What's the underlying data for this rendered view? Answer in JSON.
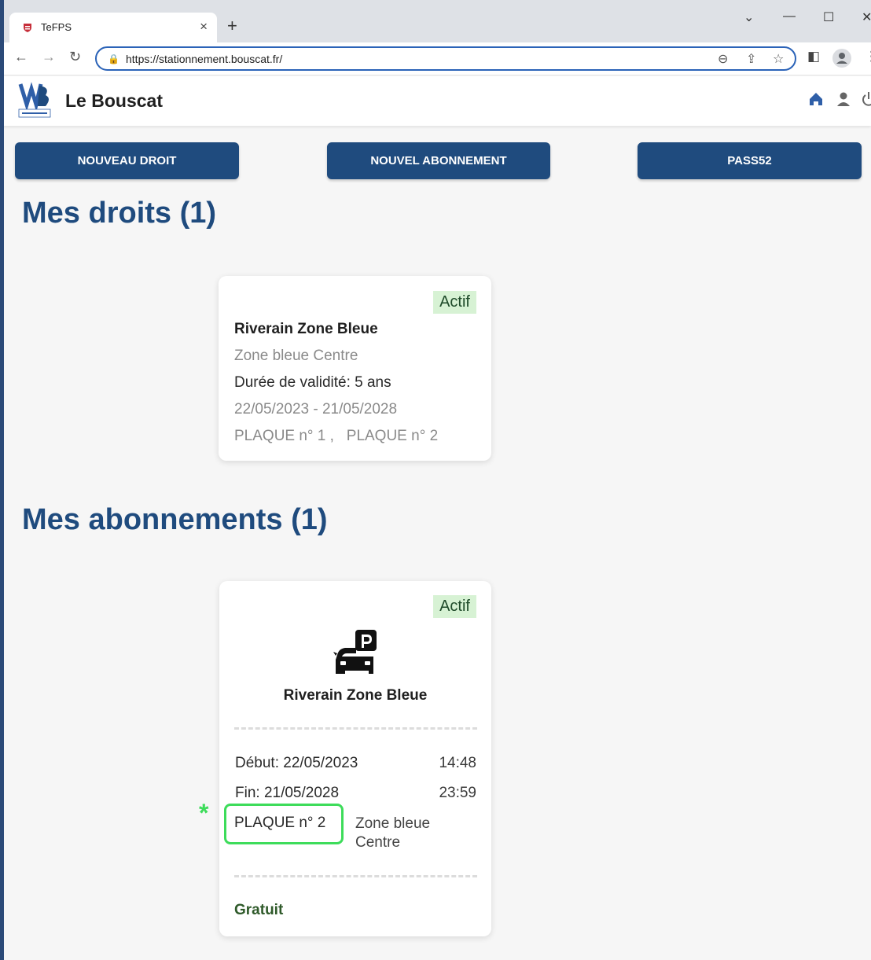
{
  "browser": {
    "tab_title": "TeFPS",
    "url": "https://stationnement.bouscat.fr/"
  },
  "header": {
    "brand": "Le Bouscat"
  },
  "actions": {
    "nouveau_droit": "NOUVEAU DROIT",
    "nouvel_abonnement": "NOUVEL ABONNEMENT",
    "pass52": "PASS52"
  },
  "droits": {
    "title": "Mes droits (1)",
    "card": {
      "status": "Actif",
      "name": "Riverain Zone Bleue",
      "zone": "Zone bleue Centre",
      "validity": "Durée de validité: 5 ans",
      "period": "22/05/2023 - 21/05/2028",
      "plates": "PLAQUE n° 1 ,   PLAQUE n° 2"
    }
  },
  "abonnements": {
    "title": "Mes abonnements (1)",
    "card": {
      "status": "Actif",
      "name": "Riverain Zone Bleue",
      "start_date": "Début: 22/05/2023",
      "start_time": "14:48",
      "end_date": "Fin: 21/05/2028",
      "end_time": "23:59",
      "plate": "PLAQUE n° 2",
      "zone": "Zone bleue Centre",
      "price": "Gratuit",
      "marker": "*"
    }
  },
  "colors": {
    "primary": "#1f4b7e",
    "active_badge_bg": "#d7f2d4",
    "highlight": "#3ddc5a"
  }
}
